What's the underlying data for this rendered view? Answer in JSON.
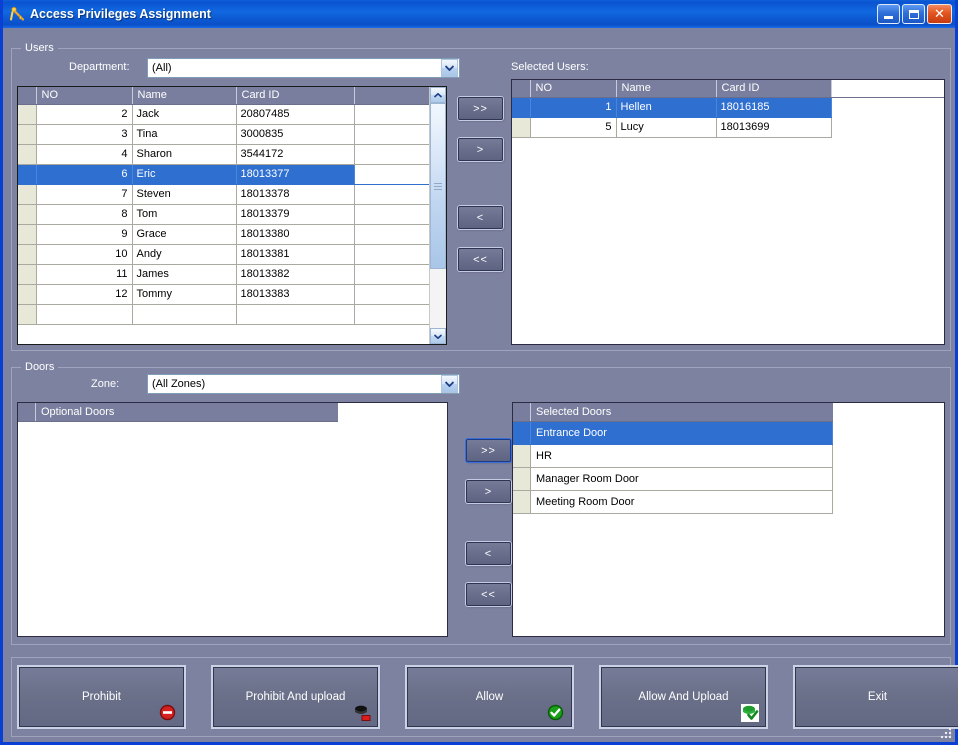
{
  "window": {
    "title": "Access Privileges Assignment",
    "icon": "key-person-icon",
    "minimize_label": "Minimize",
    "maximize_label": "Maximize",
    "close_label": "Close",
    "accent_title_blue": "#0a53d0",
    "background": "#7d82a0",
    "selection_blue": "#2f6fd0",
    "grid_header": "#797e9e"
  },
  "users_group": {
    "legend": "Users",
    "department_label": "Department:",
    "department_value": "(All)",
    "selected_users_label": "Selected Users:",
    "columns": [
      "NO",
      "Name",
      "Card ID"
    ],
    "available": [
      {
        "no": "2",
        "name": "Jack",
        "card_id": "20807485",
        "selected": false
      },
      {
        "no": "3",
        "name": "Tina",
        "card_id": "3000835",
        "selected": false
      },
      {
        "no": "4",
        "name": "Sharon",
        "card_id": "3544172",
        "selected": false
      },
      {
        "no": "6",
        "name": "Eric",
        "card_id": "18013377",
        "selected": true
      },
      {
        "no": "7",
        "name": "Steven",
        "card_id": "18013378",
        "selected": false
      },
      {
        "no": "8",
        "name": "Tom",
        "card_id": "18013379",
        "selected": false
      },
      {
        "no": "9",
        "name": "Grace",
        "card_id": "18013380",
        "selected": false
      },
      {
        "no": "10",
        "name": "Andy",
        "card_id": "18013381",
        "selected": false
      },
      {
        "no": "11",
        "name": "James",
        "card_id": "18013382",
        "selected": false
      },
      {
        "no": "12",
        "name": "Tommy",
        "card_id": "18013383",
        "selected": false
      }
    ],
    "selected": [
      {
        "no": "1",
        "name": "Hellen",
        "card_id": "18016185",
        "selected": true
      },
      {
        "no": "5",
        "name": "Lucy",
        "card_id": "18013699",
        "selected": false
      }
    ],
    "transfer_buttons": [
      {
        "label": ">>",
        "name": "add-all-users-button"
      },
      {
        "label": ">",
        "name": "add-user-button"
      },
      {
        "label": "<",
        "name": "remove-user-button"
      },
      {
        "label": "<<",
        "name": "remove-all-users-button"
      }
    ]
  },
  "doors_group": {
    "legend": "Doors",
    "zone_label": "Zone:",
    "zone_value": "(All Zones)",
    "optional_doors_header": "Optional Doors",
    "selected_doors_header": "Selected Doors",
    "optional_doors": [],
    "selected_doors": [
      {
        "name": "Entrance Door",
        "selected": true
      },
      {
        "name": "HR",
        "selected": false
      },
      {
        "name": "Manager Room Door",
        "selected": false
      },
      {
        "name": "Meeting Room Door",
        "selected": false
      }
    ],
    "transfer_buttons": [
      {
        "label": ">>",
        "name": "add-all-doors-button",
        "focused": true
      },
      {
        "label": ">",
        "name": "add-door-button",
        "focused": false
      },
      {
        "label": "<",
        "name": "remove-door-button",
        "focused": false
      },
      {
        "label": "<<",
        "name": "remove-all-doors-button",
        "focused": false
      }
    ]
  },
  "actions": [
    {
      "label": "Prohibit",
      "name": "prohibit-button",
      "icon": "deny-circle-icon"
    },
    {
      "label": "Prohibit And upload",
      "name": "prohibit-and-upload-button",
      "icon": "prohibit-upload-icon"
    },
    {
      "label": "Allow",
      "name": "allow-button",
      "icon": "green-check-icon"
    },
    {
      "label": "Allow And Upload",
      "name": "allow-and-upload-button",
      "icon": "allow-upload-icon"
    },
    {
      "label": "Exit",
      "name": "exit-button",
      "icon": ""
    }
  ],
  "scrollbar": {
    "up_label": "Scroll up",
    "down_label": "Scroll down"
  }
}
